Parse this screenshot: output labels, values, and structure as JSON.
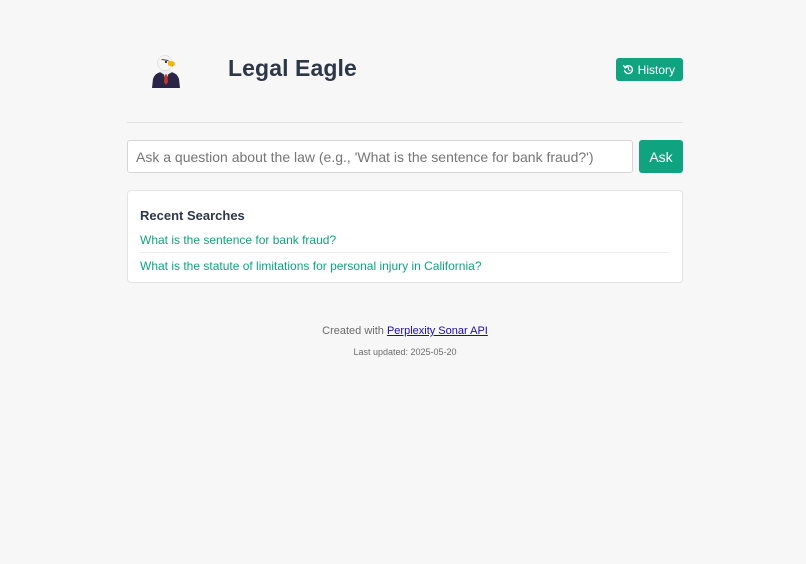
{
  "header": {
    "title": "Legal Eagle",
    "history_label": "History"
  },
  "search": {
    "placeholder": "Ask a question about the law (e.g., 'What is the sentence for bank fraud?')",
    "value": "",
    "ask_label": "Ask"
  },
  "recent": {
    "title": "Recent Searches",
    "items": [
      "What is the sentence for bank fraud?",
      "What is the statute of limitations for personal injury in California?"
    ]
  },
  "footer": {
    "created_prefix": "Created with ",
    "link_text": "Perplexity Sonar API",
    "last_updated": "Last updated: 2025-05-20"
  },
  "colors": {
    "accent": "#10a37f",
    "text": "#2d3748",
    "background": "#f7f7f7",
    "link": "#1a0dab"
  },
  "icons": {
    "logo": "eagle-logo-icon",
    "history": "history-icon"
  }
}
